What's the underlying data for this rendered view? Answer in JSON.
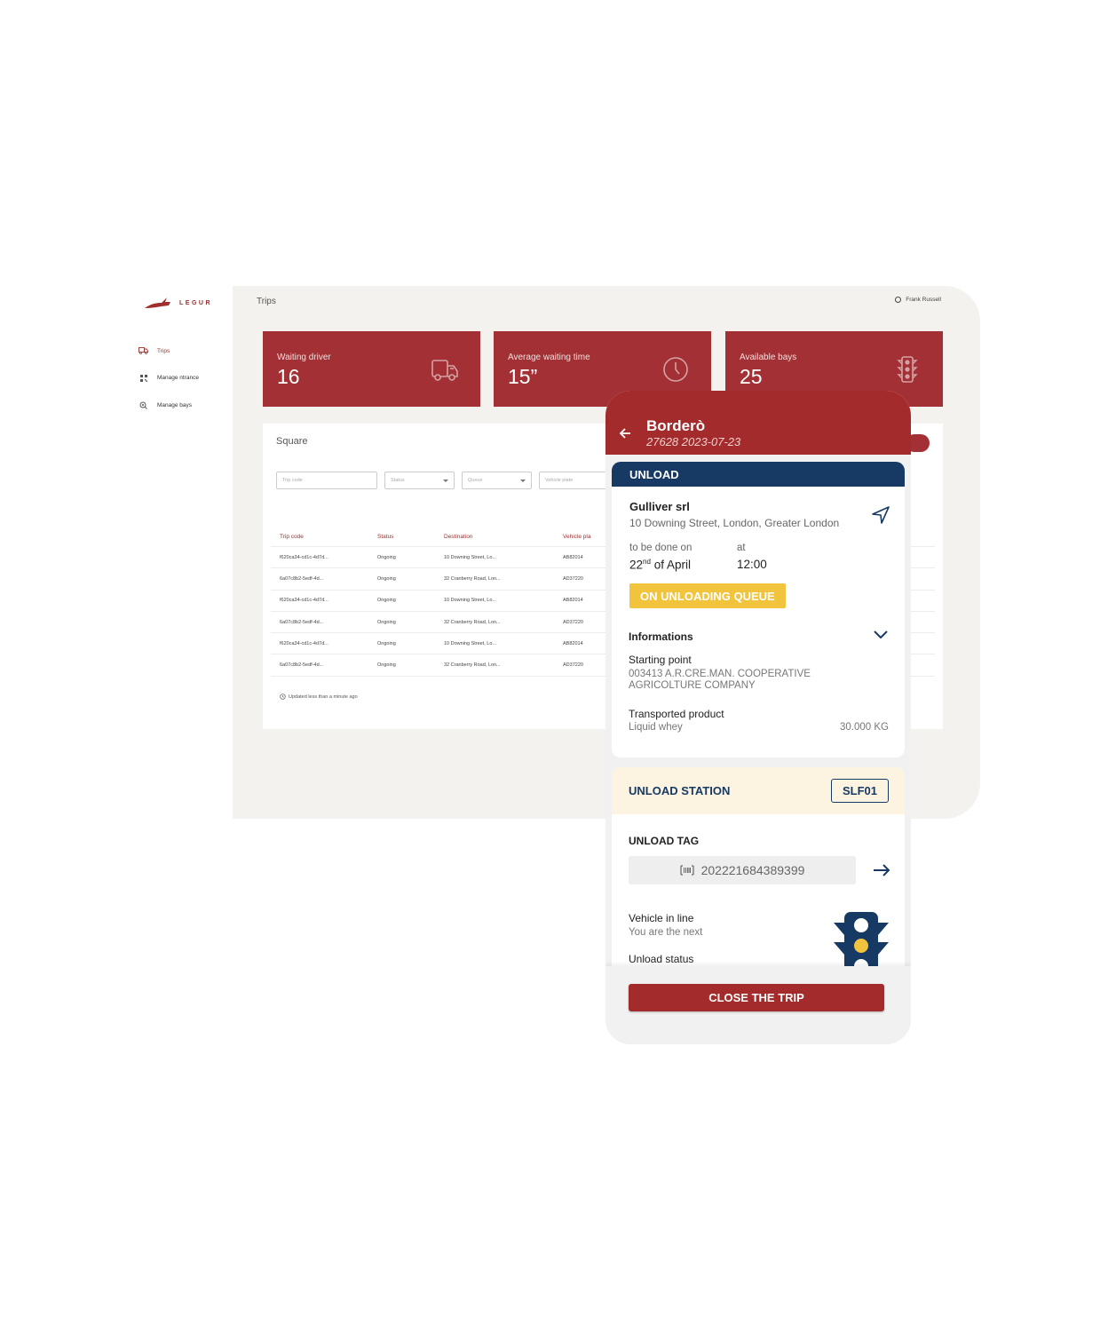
{
  "app": {
    "brand": "LEGUR",
    "colors": {
      "brand_red": "#a23034",
      "navy": "#173a64",
      "queue_yellow": "#f2c43d",
      "station_bg": "#fcf4e0"
    }
  },
  "sidebar": {
    "items": [
      {
        "label": "Trips",
        "icon": "truck-icon",
        "active": true
      },
      {
        "label": "Manage ntrance",
        "icon": "qr-grid-icon",
        "active": false
      },
      {
        "label": "Manage bays",
        "icon": "bays-gear-icon",
        "active": false
      }
    ]
  },
  "header": {
    "title": "Trips",
    "user": "Frank Russell"
  },
  "stats": [
    {
      "label": "Waiting driver",
      "value": "16",
      "icon": "truck-icon"
    },
    {
      "label": "Average waiting time",
      "value": "15”",
      "icon": "clock-icon"
    },
    {
      "label": "Available bays",
      "value": "25",
      "icon": "traffic-light-icon"
    }
  ],
  "table_card": {
    "title": "Square",
    "filters": {
      "trip_code_placeholder": "Trip code",
      "status_placeholder": "Status",
      "queue_placeholder": "Queue",
      "vehicle_plate_placeholder": "Vehicle plate"
    },
    "columns": [
      "Trip code",
      "Status",
      "Destination",
      "Vehicle pla"
    ],
    "rows": [
      [
        "f620ca34-cd1c-4d7d...",
        "Ongoing",
        "10 Downing Street, Lo...",
        "AB82014"
      ],
      [
        "6a07c8b2-5edf-4d...",
        "Ongoing",
        "32 Cranberry Road, Lon...",
        "AD37220"
      ],
      [
        "f620ca34-cd1c-4d7d...",
        "Ongoing",
        "10 Downing Street, Lo...",
        "AB82014"
      ],
      [
        "6a07c8b2-5edf-4d...",
        "Ongoing",
        "32 Cranberry Road, Lon...",
        "AD37220"
      ],
      [
        "f620ca34-cd1c-4d7d...",
        "Ongoing",
        "10 Downing Street, Lo...",
        "AB82014"
      ],
      [
        "6a07c8b2-5edf-4d...",
        "Ongoing",
        "32 Cranberry Road, Lon...",
        "AD37220"
      ]
    ],
    "updated": "Updated less than a minute ago"
  },
  "mobile": {
    "title": "Borderò",
    "subtitle": "27628 2023-07-23",
    "unload": {
      "header": "UNLOAD",
      "company": "Gulliver srl",
      "address": "10 Downing Street, London, Greater London",
      "date_label": "to be done on",
      "date_day": "22",
      "date_suffix": "nd",
      "date_rest": " of April",
      "time_label": "at",
      "time_value": "12:00",
      "status_badge": "ON UNLOADING QUEUE",
      "informations_label": "Informations",
      "starting_point_label": "Starting point",
      "starting_point_line1": "003413 A.R.CRE.MAN. COOPERATIVE",
      "starting_point_line2": "AGRICOLTURE COMPANY",
      "product_label": "Transported product",
      "product_value": "Liquid whey",
      "quantity": "30.000 KG"
    },
    "station": {
      "title": "UNLOAD STATION",
      "code": "SLF01",
      "tag_label": "UNLOAD TAG",
      "tag_value": "202221684389399",
      "vehicle_in_line_label": "Vehicle in line",
      "vehicle_in_line_value": "You are the next",
      "unload_status_label": "Unload status"
    },
    "close_button": "CLOSE THE TRIP"
  }
}
